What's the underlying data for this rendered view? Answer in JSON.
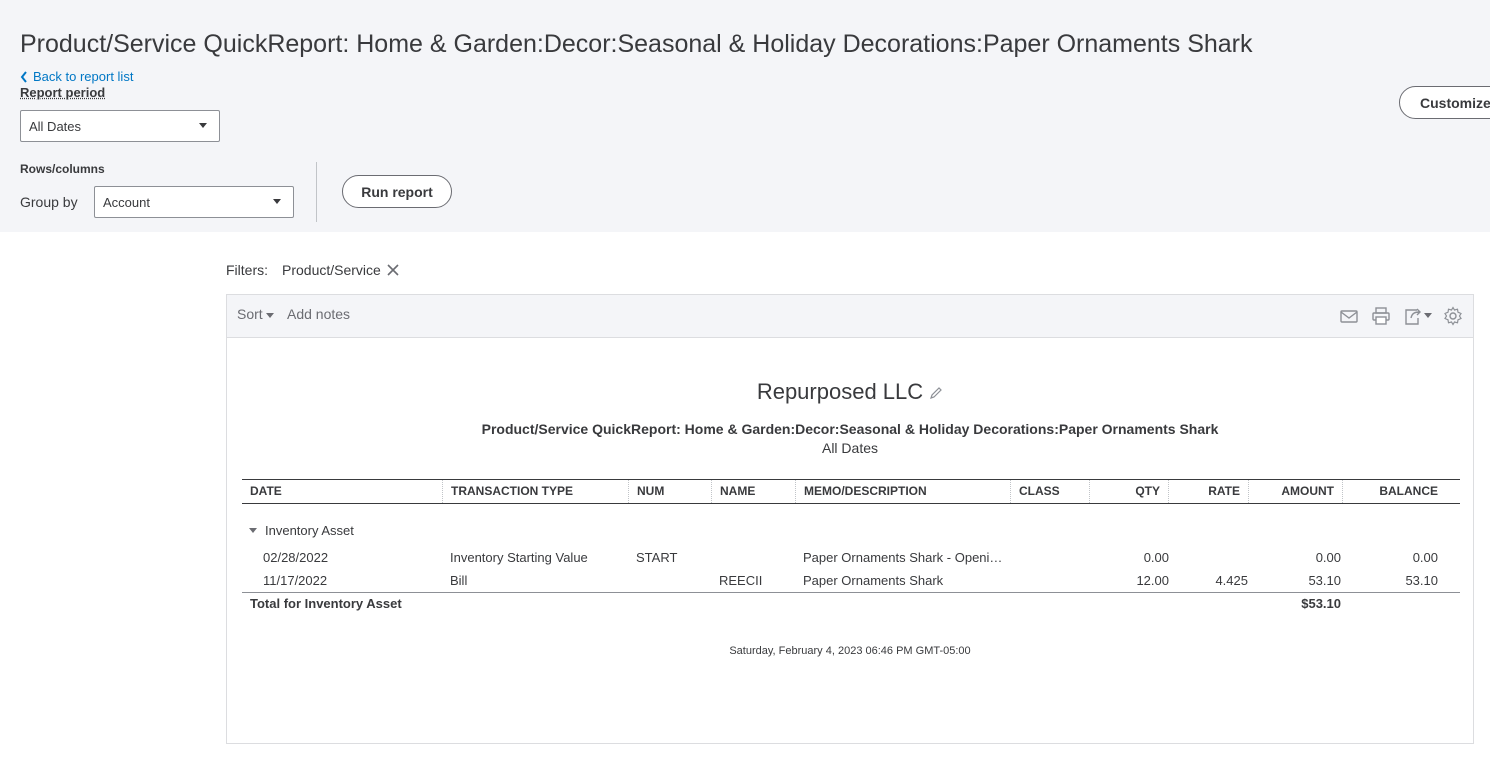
{
  "header": {
    "title": "Product/Service QuickReport: Home & Garden:Decor:Seasonal & Holiday Decorations:Paper Ornaments Shark",
    "back_link": "Back to report list",
    "report_period_label": "Report period",
    "report_period_value": "All Dates",
    "rows_columns_label": "Rows/columns",
    "group_by_label": "Group by",
    "group_by_value": "Account",
    "run_report_label": "Run report",
    "customize_label": "Customize"
  },
  "filters": {
    "label": "Filters:",
    "chip": "Product/Service"
  },
  "toolbar": {
    "sort_label": "Sort",
    "add_notes_label": "Add notes",
    "icons": [
      "email-icon",
      "print-icon",
      "export-icon",
      "settings-icon"
    ]
  },
  "report": {
    "company": "Repurposed LLC",
    "title": "Product/Service QuickReport: Home & Garden:Decor:Seasonal & Holiday Decorations:Paper Ornaments Shark",
    "period": "All Dates",
    "columns": [
      "DATE",
      "TRANSACTION TYPE",
      "NUM",
      "NAME",
      "MEMO/DESCRIPTION",
      "CLASS",
      "QTY",
      "RATE",
      "AMOUNT",
      "BALANCE"
    ],
    "group_name": "Inventory Asset",
    "rows": [
      {
        "date": "02/28/2022",
        "type": "Inventory Starting Value",
        "num": "START",
        "name": "",
        "memo": "Paper Ornaments Shark - Openi…",
        "class": "",
        "qty": "0.00",
        "rate": "",
        "amount": "0.00",
        "balance": "0.00"
      },
      {
        "date": "11/17/2022",
        "type": "Bill",
        "num": "",
        "name": "REECII",
        "memo": "Paper Ornaments Shark",
        "class": "",
        "qty": "12.00",
        "rate": "4.425",
        "amount": "53.10",
        "balance": "53.10"
      }
    ],
    "total_label": "Total for Inventory Asset",
    "total_amount": "$53.10",
    "timestamp": "Saturday, February 4, 2023   06:46 PM GMT-05:00"
  }
}
